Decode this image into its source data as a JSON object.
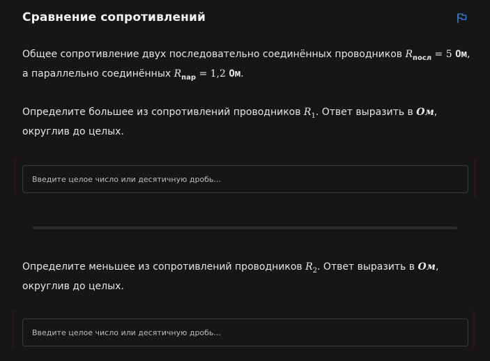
{
  "task": {
    "title": "Сравнение сопротивлений",
    "flag_icon": "flag-icon",
    "accent_color": "#3d7fe0"
  },
  "condition": {
    "prefix": "Общее сопротивление двух последовательно соединённых проводников ",
    "r_series_symbol": "R",
    "r_series_sub": "посл",
    "r_series_eq": " = 5 ",
    "r_series_unit": "Ом",
    "middle": ", а параллельно соединённых ",
    "r_parallel_symbol": "R",
    "r_parallel_sub": "пар",
    "r_parallel_eq": " = 1,2 ",
    "r_parallel_unit": "Ом",
    "suffix": "."
  },
  "question1": {
    "prefix": "Определите большее из сопротивлений проводников ",
    "symbol": "R",
    "sub": "1",
    "middle": ". Ответ выразить в ",
    "unit": "Ом",
    "suffix": ", округлив до целых.",
    "input_placeholder": "Введите целое число или десятичную дробь...",
    "input_value": ""
  },
  "question2": {
    "prefix": "Определите меньшее из сопротивлений проводников ",
    "symbol": "R",
    "sub": "2",
    "middle": ". Ответ выразить в ",
    "unit": "Ом",
    "suffix": ", округлив до целых.",
    "input_placeholder": "Введите целое число или десятичную дробь...",
    "input_value": ""
  }
}
